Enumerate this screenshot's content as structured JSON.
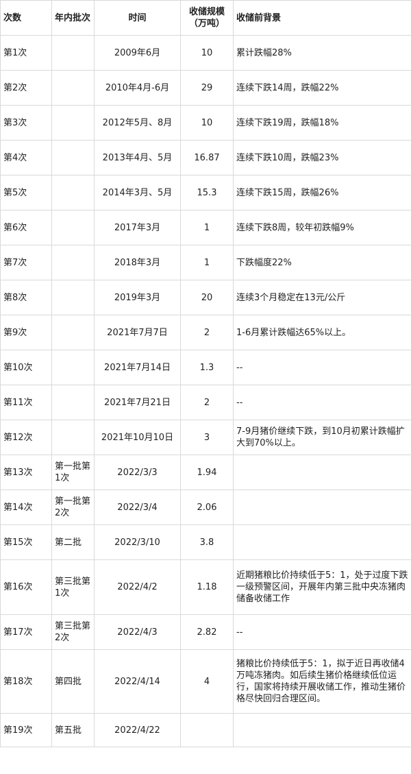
{
  "headers": {
    "count": "次数",
    "batch": "年内批次",
    "time": "时间",
    "scale": "收储规模（万吨）",
    "background": "收储前背景"
  },
  "rows": [
    {
      "count": "第1次",
      "batch": "",
      "time": "2009年6月",
      "scale": "10",
      "background": "累计跌幅28%"
    },
    {
      "count": "第2次",
      "batch": "",
      "time": "2010年4月-6月",
      "scale": "29",
      "background": "连续下跌14周，跌幅22%"
    },
    {
      "count": "第3次",
      "batch": "",
      "time": "2012年5月、8月",
      "scale": "10",
      "background": "连续下跌19周，跌幅18%"
    },
    {
      "count": "第4次",
      "batch": "",
      "time": "2013年4月、5月",
      "scale": "16.87",
      "background": "连续下跌10周，跌幅23%"
    },
    {
      "count": "第5次",
      "batch": "",
      "time": "2014年3月、5月",
      "scale": "15.3",
      "background": "连续下跌15周，跌幅26%"
    },
    {
      "count": "第6次",
      "batch": "",
      "time": "2017年3月",
      "scale": "1",
      "background": "连续下跌8周，较年初跌幅9%"
    },
    {
      "count": "第7次",
      "batch": "",
      "time": "2018年3月",
      "scale": "1",
      "background": "下跌幅度22%"
    },
    {
      "count": "第8次",
      "batch": "",
      "time": "2019年3月",
      "scale": "20",
      "background": "连续3个月稳定在13元/公斤"
    },
    {
      "count": "第9次",
      "batch": "",
      "time": "2021年7月7日",
      "scale": "2",
      "background": "1-6月累计跌幅达65%以上。"
    },
    {
      "count": "第10次",
      "batch": "",
      "time": "2021年7月14日",
      "scale": "1.3",
      "background": "--"
    },
    {
      "count": "第11次",
      "batch": "",
      "time": "2021年7月21日",
      "scale": "2",
      "background": "--"
    },
    {
      "count": "第12次",
      "batch": "",
      "time": "2021年10月10日",
      "scale": "3",
      "background": "7-9月猪价继续下跌，到10月初累计跌幅扩大到70%以上。"
    },
    {
      "count": "第13次",
      "batch": "第一批第1次",
      "time": "2022/3/3",
      "scale": "1.94",
      "background": ""
    },
    {
      "count": "第14次",
      "batch": "第一批第2次",
      "time": "2022/3/4",
      "scale": "2.06",
      "background": ""
    },
    {
      "count": "第15次",
      "batch": "第二批",
      "time": "2022/3/10",
      "scale": "3.8",
      "background": ""
    },
    {
      "count": "第16次",
      "batch": "第三批第1次",
      "time": "2022/4/2",
      "scale": "1.18",
      "background": "近期猪粮比价持续低于5：1，处于过度下跌一级预警区间，开展年内第三批中央冻猪肉储备收储工作"
    },
    {
      "count": "第17次",
      "batch": "第三批第2次",
      "time": "2022/4/3",
      "scale": "2.82",
      "background": "--"
    },
    {
      "count": "第18次",
      "batch": "第四批",
      "time": "2022/4/14",
      "scale": "4",
      "background": "猪粮比价持续低于5：1，拟于近日再收储4万吨冻猪肉。如后续生猪价格继续低位运行，国家将持续开展收储工作，推动生猪价格尽快回归合理区间。"
    },
    {
      "count": "第19次",
      "batch": "第五批",
      "time": "2022/4/22",
      "scale": "",
      "background": ""
    }
  ]
}
